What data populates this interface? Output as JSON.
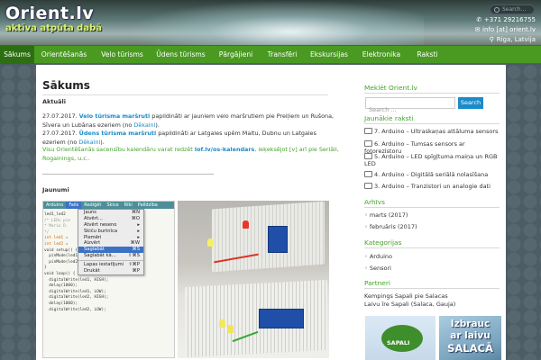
{
  "header": {
    "logo_title": "Orient.lv",
    "logo_tagline": "aktīva atpūta dabā",
    "search_placeholder": "Search...",
    "phone": "+371 29216755",
    "email": "info [at] orient.lv",
    "location": "Riga, Latvija",
    "icons": {
      "phone": "phone-icon",
      "email": "envelope-icon",
      "location": "map-pin-icon",
      "search": "search-icon"
    }
  },
  "nav": [
    {
      "label": "Sākums",
      "active": true
    },
    {
      "label": "Orientēšanās",
      "active": false
    },
    {
      "label": "Velo tūrisms",
      "active": false
    },
    {
      "label": "Ūdens tūrisms",
      "active": false
    },
    {
      "label": "Pārgājieni",
      "active": false
    },
    {
      "label": "Transfēri",
      "active": false
    },
    {
      "label": "Ekskursijas",
      "active": false
    },
    {
      "label": "Elektronika",
      "active": false
    },
    {
      "label": "Raksti",
      "active": false
    }
  ],
  "main": {
    "title": "Sākums",
    "aktuali_heading": "Aktuāli",
    "news1": {
      "date": "27.07.2017.",
      "link": "Velo tūrisma maršruti",
      "text": "papildināti ar jauniem velo maršrutiem pie Preiļiem un Rušona, Sīvera un Lubānas ezeriem (no",
      "source": "Dēkalni",
      "tail": ")."
    },
    "news2": {
      "date": "27.07.2017.",
      "link": "Ūdens tūrisma maršruti",
      "text": "papildināti ar Latgales upēm Maltu, Dubnu un Latgales ezeriem (no",
      "source": "Dēkalni",
      "tail": ")."
    },
    "news3": {
      "text": "Visu Orientēšanās sacensību kalendāru varat redzēt",
      "link": "lof.lv/os-kalendars",
      "rest": ", ieķeksējot [v] arī pie Seriāli, Rogainings, u.c.."
    },
    "jaunumi_heading": "Jaunumi",
    "ide": {
      "menubar": [
        "Arduino",
        "Fails",
        "Rediģēt",
        "Skice",
        "Rīki",
        "Palīdzība"
      ],
      "menu_items": [
        {
          "label": "Jauns",
          "shortcut": "⌘N"
        },
        {
          "label": "Atvērt...",
          "shortcut": "⌘O"
        },
        {
          "label": "Atvērt neseno",
          "shortcut": "▸"
        },
        {
          "label": "Skiču burtnīca",
          "shortcut": "▸"
        },
        {
          "label": "Piemēri",
          "shortcut": "▸"
        },
        {
          "label": "Aizvērt",
          "shortcut": "⌘W"
        },
        {
          "label": "Saglabāt",
          "shortcut": "⌘S",
          "highlight": true
        },
        {
          "label": "Saglabāt kā...",
          "shortcut": "⇧⌘S"
        },
        {
          "label": "Lapas iestatījumi",
          "shortcut": "⇧⌘P"
        },
        {
          "label": "Drukāt",
          "shortcut": "⌘P"
        }
      ],
      "code_lines": [
        "led1_led2",
        "/* LEDs pie",
        "* Mario D.",
        "*/",
        "int led1 =",
        "int led2 =",
        "void setup() {",
        "  pinMode(led1, OUTPUT);",
        "  pinMode(led2, OUTPUT);",
        "}",
        "void loop() {",
        "  digitalWrite(led1, HIGH);",
        "  delay(1000);",
        "  digitalWrite(led1, LOW);",
        "  digitalWrite(led2, HIGH);",
        "  delay(1000);",
        "  digitalWrite(led2, LOW);"
      ]
    }
  },
  "sidebar": {
    "search_heading": "Meklēt Orient.lv",
    "search_placeholder": "Search ...",
    "search_button": "Search",
    "recent_heading": "Jaunākie raksti",
    "recent": [
      "7. Arduino – Ultraskaņas attāluma sensors",
      "6. Arduino – Tumsas sensors ar fotorezistoru",
      "5. Arduino – LED spīgļtuma maiņa un RGB LED",
      "4. Arduino – Digitālā seriālā nolasīšana",
      "3. Arduino – Tranzistori un analogie dati"
    ],
    "archive_heading": "Arhīvs",
    "archive": [
      "marts (2017)",
      "februāris (2017)"
    ],
    "categories_heading": "Kategorijas",
    "categories": [
      "Arduino",
      "Sensori"
    ],
    "partners_heading": "Partneri",
    "partner1": "Kempings Sapali pie Salacas",
    "partner2": "Laivu īre Sapali (Salaca, Gauja)",
    "banner_sign": "SAPALI",
    "banner_text": [
      "Izbrauc",
      "ar laivu",
      "SALACĀ"
    ]
  },
  "colors": {
    "nav": "#4a9a22",
    "nav_active": "#2c6f12",
    "link": "#1a8bc8",
    "accent_green": "#43a32a"
  }
}
